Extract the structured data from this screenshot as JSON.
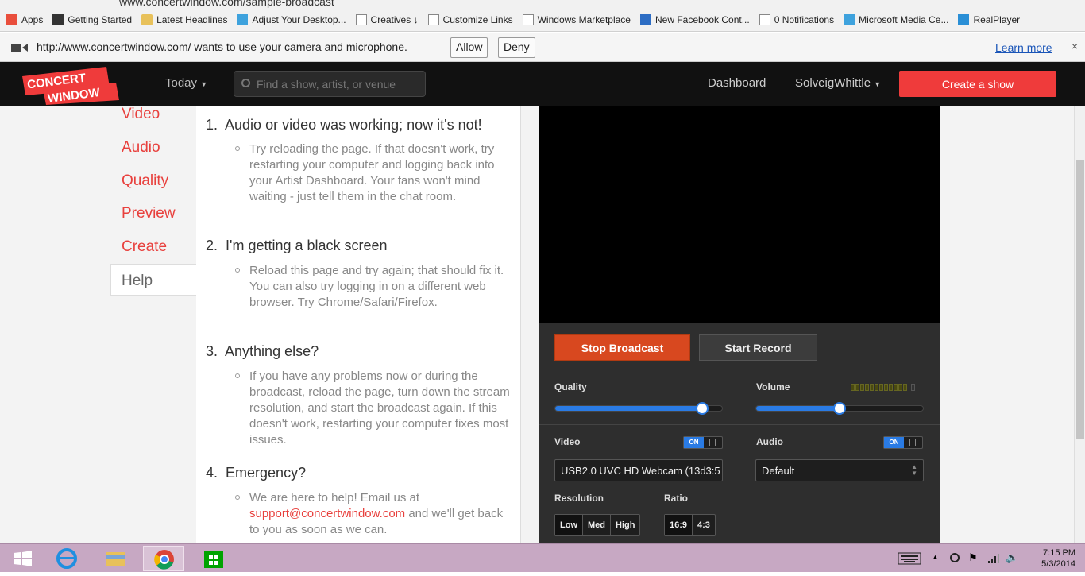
{
  "browser": {
    "url": "www.concertwindow.com/sample-broadcast",
    "bookmarks": [
      {
        "label": "Apps",
        "icon": "apps-grid-icon"
      },
      {
        "label": "Getting Started",
        "icon": "m-logo-icon"
      },
      {
        "label": "Latest Headlines",
        "icon": "folder-icon"
      },
      {
        "label": "Adjust Your Desktop...",
        "icon": "windows-logo-icon"
      },
      {
        "label": "Creatives ↓",
        "icon": "page-icon"
      },
      {
        "label": "Customize Links",
        "icon": "page-icon"
      },
      {
        "label": "Windows Marketplace",
        "icon": "page-icon"
      },
      {
        "label": "New Facebook Cont...",
        "icon": "magnifier-icon"
      },
      {
        "label": "0 Notifications",
        "icon": "page-icon"
      },
      {
        "label": "Microsoft Media Ce...",
        "icon": "windows-logo-icon"
      },
      {
        "label": "RealPlayer",
        "icon": "realplayer-icon"
      }
    ],
    "permission": {
      "message": "http://www.concertwindow.com/ wants to use your camera and microphone.",
      "allow": "Allow",
      "deny": "Deny",
      "learn_more": "Learn more",
      "close": "×"
    }
  },
  "site": {
    "logo_line1": "CONCERT",
    "logo_line2": "WINDOW",
    "today": "Today",
    "search_placeholder": "Find a show, artist, or venue",
    "dashboard": "Dashboard",
    "username": "SolveigWhittle",
    "create_show": "Create a show"
  },
  "sidebar": {
    "items": [
      "Video",
      "Audio",
      "Quality",
      "Preview",
      "Create",
      "Help"
    ],
    "active": "Help"
  },
  "help": {
    "items": [
      {
        "num": "1.",
        "title": "Audio or video was working; now it's not!",
        "body": "Try reloading the page. If that doesn't work, try restarting your computer and logging back into your Artist Dashboard. Your fans won't mind waiting - just tell them in the chat room."
      },
      {
        "num": "2.",
        "title": "I'm getting a black screen",
        "body": "Reload this page and try again; that should fix it. You can also try logging in on a different web browser. Try Chrome/Safari/Firefox."
      },
      {
        "num": "3.",
        "title": "Anything else?",
        "body": "If you have any problems now or during the broadcast, reload the page, turn down the stream resolution, and start the broadcast again. If this doesn't work, restarting your computer fixes most issues."
      },
      {
        "num": "4.",
        "title": "Emergency?",
        "body_pre": "We are here to help! Email us at ",
        "email": "support@concertwindow.com",
        "body_post": " and we'll get back to you as soon as we can."
      }
    ]
  },
  "broadcast": {
    "stop": "Stop Broadcast",
    "record": "Start Record",
    "quality_label": "Quality",
    "quality_level": 0.88,
    "volume_label": "Volume",
    "volume_level": 0.5,
    "video_label": "Video",
    "video_on": "ON",
    "video_source": "USB2.0 UVC HD Webcam (13d3:5",
    "audio_label": "Audio",
    "audio_on": "ON",
    "audio_source": "Default",
    "resolution_label": "Resolution",
    "resolutions": [
      "Low",
      "Med",
      "High"
    ],
    "ratio_label": "Ratio",
    "ratios": [
      "16:9",
      "4:3"
    ],
    "accent": "#2a7be4",
    "stop_color": "#d8481f"
  },
  "taskbar": {
    "time": "7:15 PM",
    "date": "5/3/2014"
  }
}
